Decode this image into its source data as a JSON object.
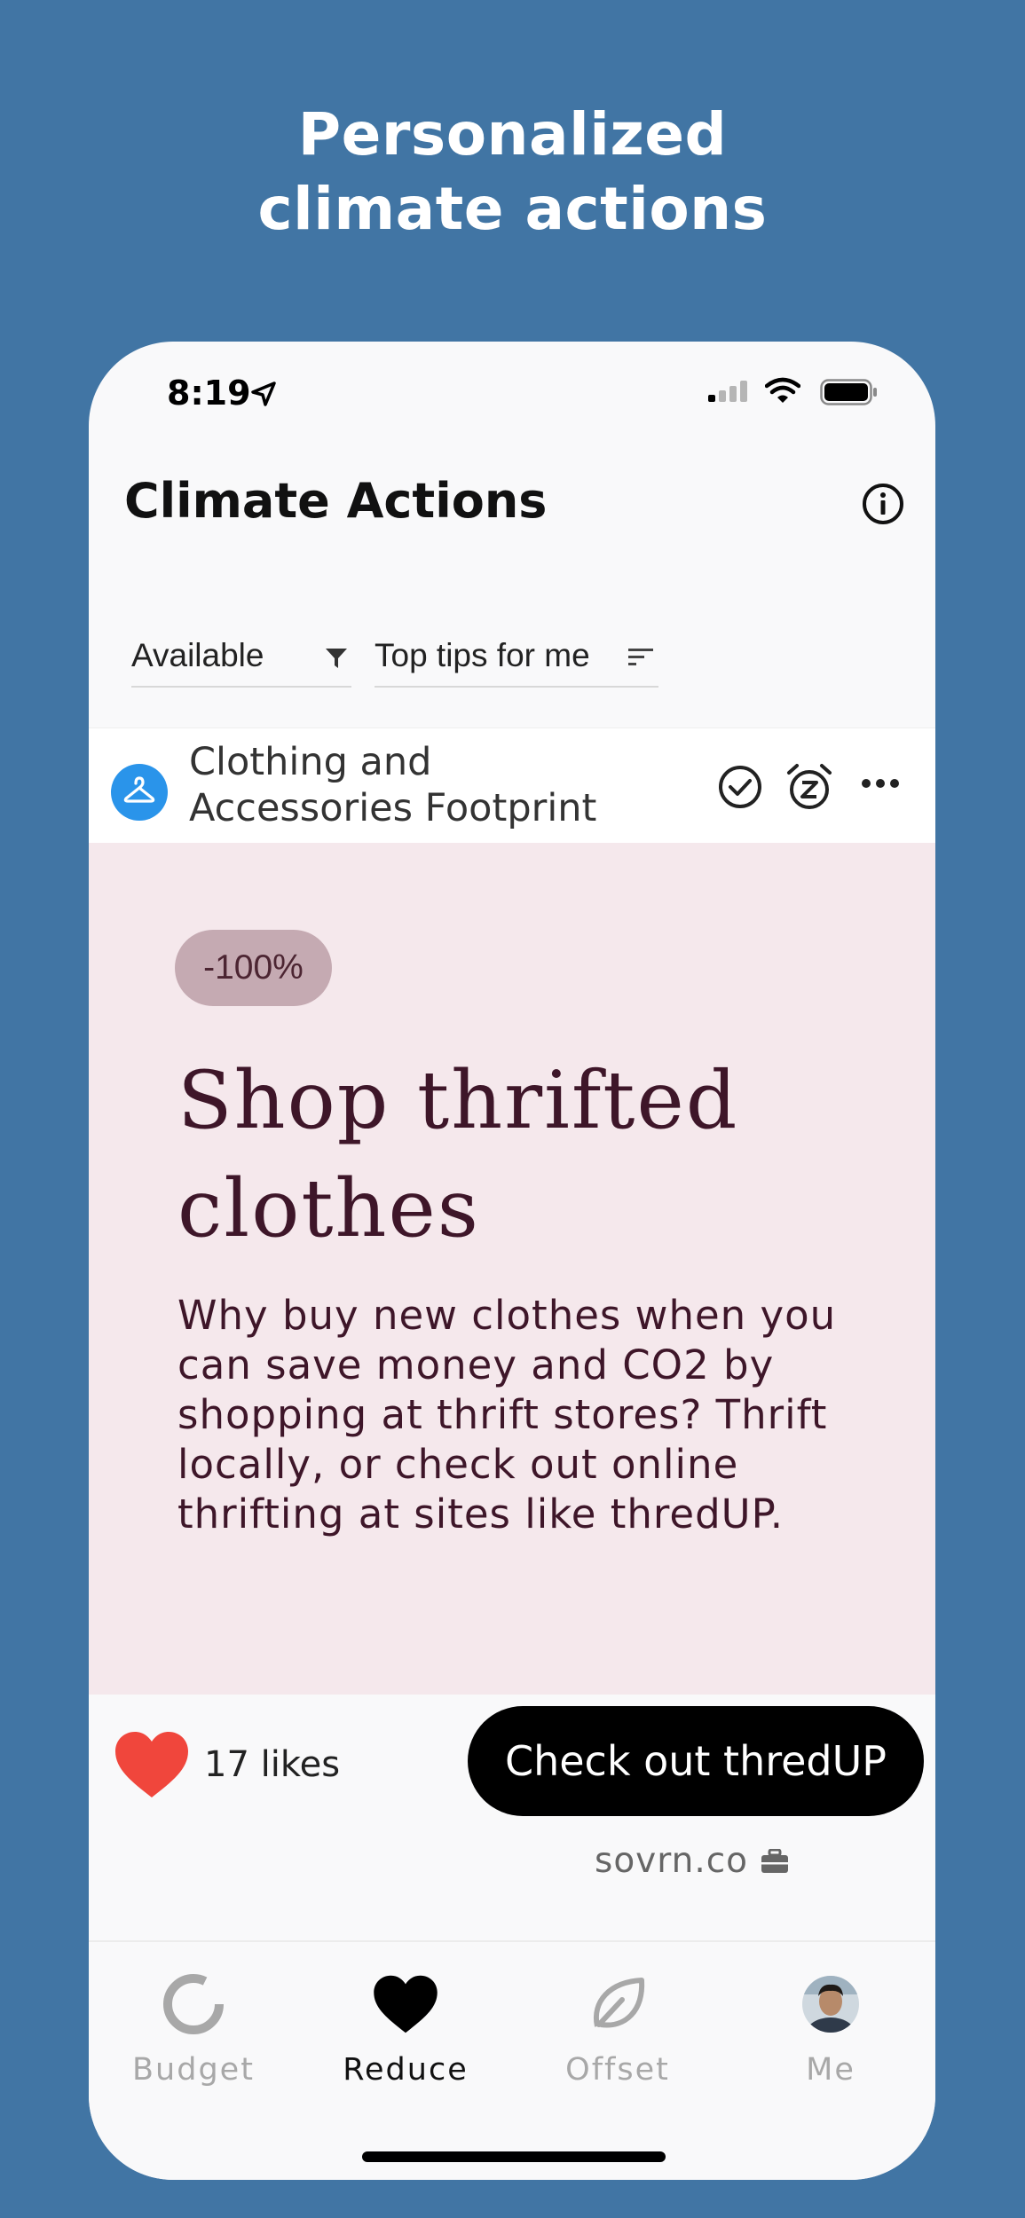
{
  "promo": {
    "headline_line1": "Personalized",
    "headline_line2": "climate actions"
  },
  "status_bar": {
    "time": "8:19"
  },
  "header": {
    "title": "Climate Actions"
  },
  "filters": {
    "availability": "Available",
    "sort": "Top tips for me"
  },
  "card": {
    "category_line1": "Clothing and",
    "category_line2": "Accessories Footprint",
    "reduction_badge": "-100%",
    "title_line1": "Shop thrifted",
    "title_line2": "clothes",
    "description": "Why buy new clothes when you can save money and CO2 by shopping at thrift stores? Thrift locally, or check out online thrifting at sites like thredUP.",
    "likes": "17 likes",
    "cta_label": "Check out thredUP",
    "sponsor": "sovrn.co"
  },
  "tabs": [
    {
      "label": "Budget",
      "icon": "donut-icon",
      "active": false
    },
    {
      "label": "Reduce",
      "icon": "heart-icon",
      "active": true
    },
    {
      "label": "Offset",
      "icon": "leaf-icon",
      "active": false
    },
    {
      "label": "Me",
      "icon": "avatar",
      "active": false
    }
  ],
  "colors": {
    "background": "#4175a4",
    "card_body": "#f5e8ec",
    "accent_text": "#3e1629",
    "heart": "#f0463c",
    "category_icon": "#2a94ea"
  }
}
